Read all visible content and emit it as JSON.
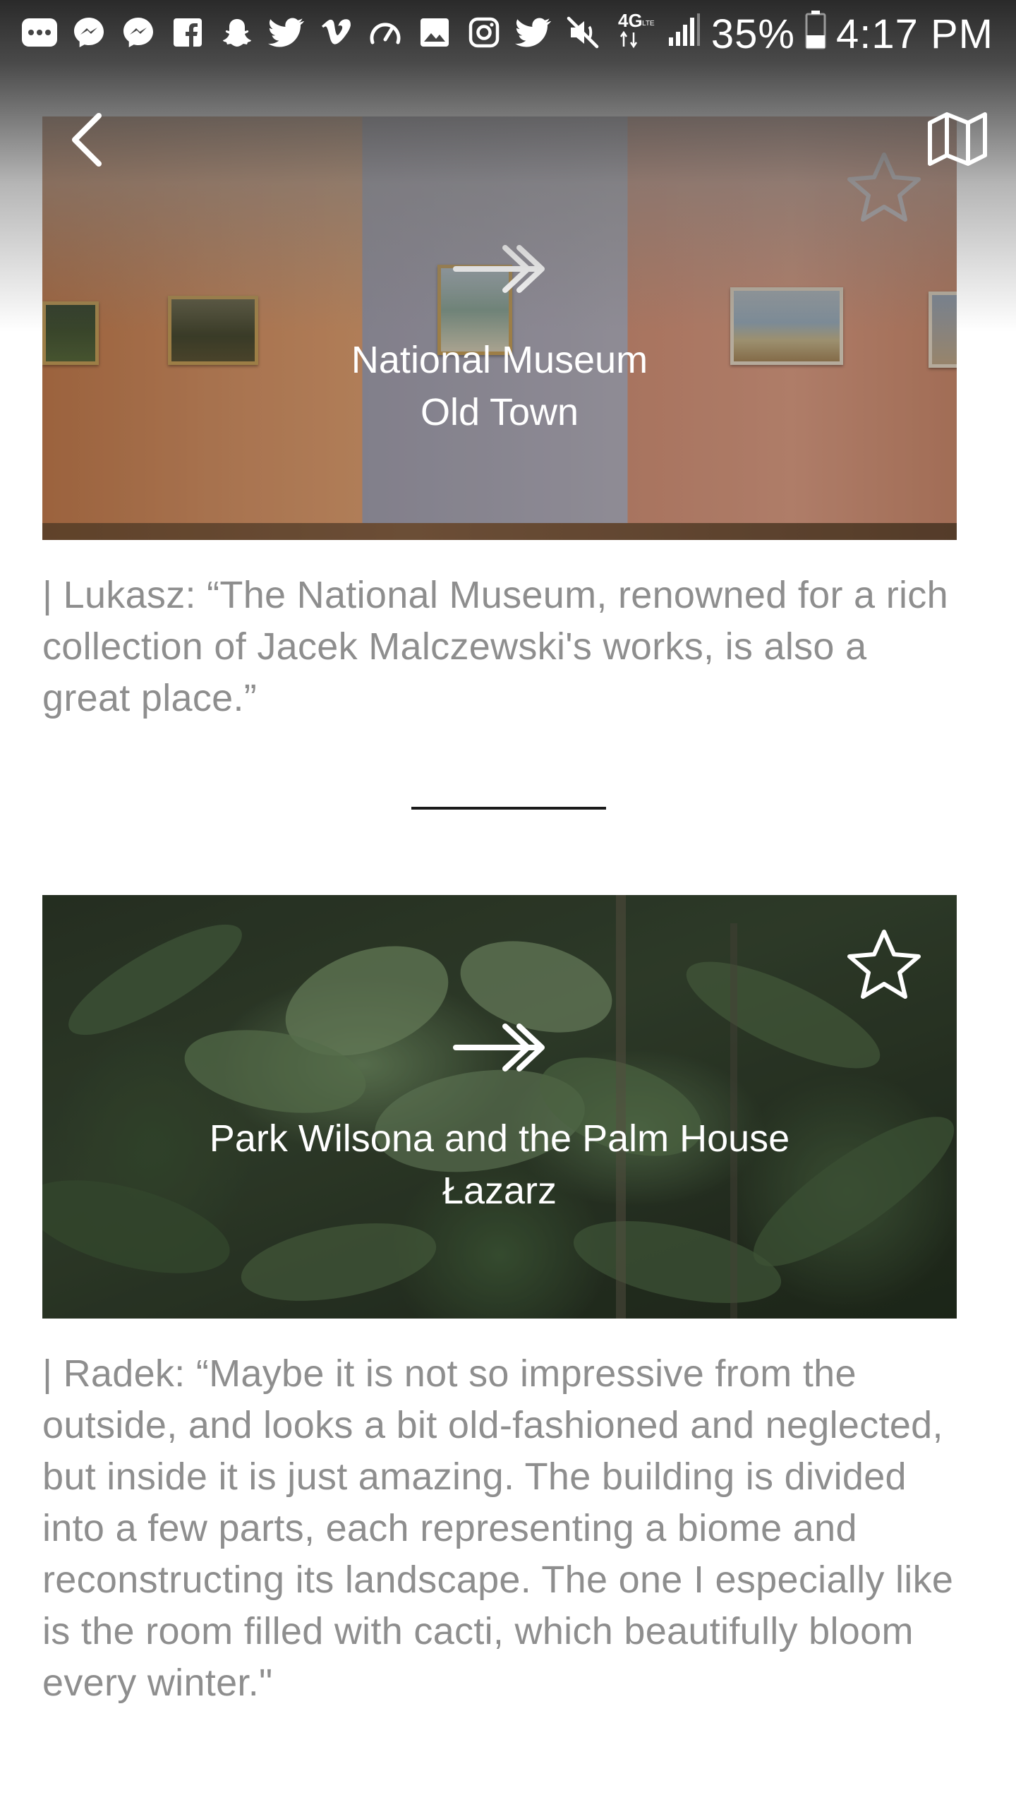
{
  "status_bar": {
    "time": "4:17 PM",
    "battery_percent": "35%",
    "network": "4G LTE",
    "icons": [
      "more-icon",
      "messenger-icon",
      "messenger-icon",
      "facebook-icon",
      "snapchat-icon",
      "twitter-icon",
      "vimeo-icon",
      "speedometer-icon",
      "gallery-icon",
      "instagram-icon",
      "twitter-icon",
      "mute-icon",
      "lte-icon",
      "signal-icon",
      "battery-icon"
    ]
  },
  "header": {
    "back_icon": "chevron-left-icon",
    "map_icon": "map-icon"
  },
  "places": [
    {
      "name": "National Museum",
      "district": "Old Town",
      "favorited": false,
      "quote": "| Lukasz: “The National Museum, renowned for a rich collection of Jacek Malczewski's works, is also a great place.”"
    },
    {
      "name": "Park Wilsona and the Palm House",
      "district": "Łazarz",
      "favorited": false,
      "quote": "| Radek: “Maybe it is not so impressive from the outside, and looks a bit old-fashioned and neglected, but inside it is just amazing. The building is divided into a few parts, each representing a biome and reconstructing its landscape. The one I especially like is the room filled with cacti, which beautifully bloom every winter.\""
    }
  ],
  "colors": {
    "quote_text": "#8e8e8e",
    "divider": "#1a1a1a",
    "card_text": "#ffffff"
  }
}
